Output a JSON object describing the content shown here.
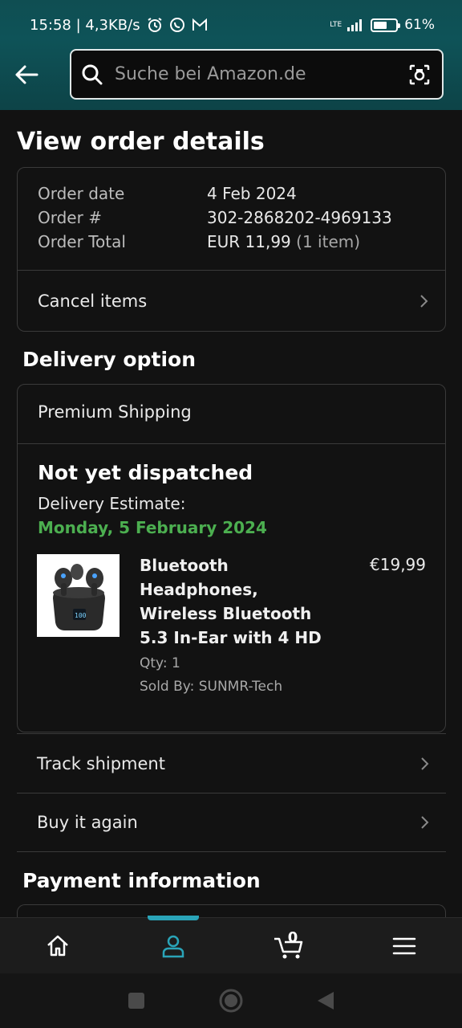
{
  "status_bar": {
    "time_speed": "15:58 | 4,3KB/s",
    "network": "LTE",
    "battery_level": 0.61,
    "battery": "61%"
  },
  "search": {
    "placeholder": "Suche bei Amazon.de"
  },
  "page": {
    "title": "View order details"
  },
  "order": {
    "labels": [
      "Order date",
      "Order #",
      "Order Total"
    ],
    "date": "4 Feb 2024",
    "number": "302-2868202-4969133",
    "total": "EUR 11,99",
    "item_count": "(1 item)",
    "cancel_label": "Cancel items"
  },
  "delivery": {
    "section_title": "Delivery option",
    "shipping_type": "Premium Shipping",
    "status": "Not yet dispatched",
    "estimate_label": "Delivery Estimate:",
    "estimate_date": "Monday, 5 February 2024",
    "product": {
      "title": "Bluetooth Headphones, Wireless Bluetooth 5.3 In-Ear with 4 HD",
      "price": "€19,99",
      "qty": "Qty: 1",
      "seller": "Sold By: SUNMR-Tech"
    }
  },
  "actions": {
    "track": "Track shipment",
    "buy_again": "Buy it again"
  },
  "payment": {
    "section_title": "Payment information"
  },
  "bottom_nav": {
    "cart_count": "0"
  },
  "colors": {
    "accent": "#2aa4b8",
    "success": "#4caf50",
    "header": "#0f4e52"
  }
}
